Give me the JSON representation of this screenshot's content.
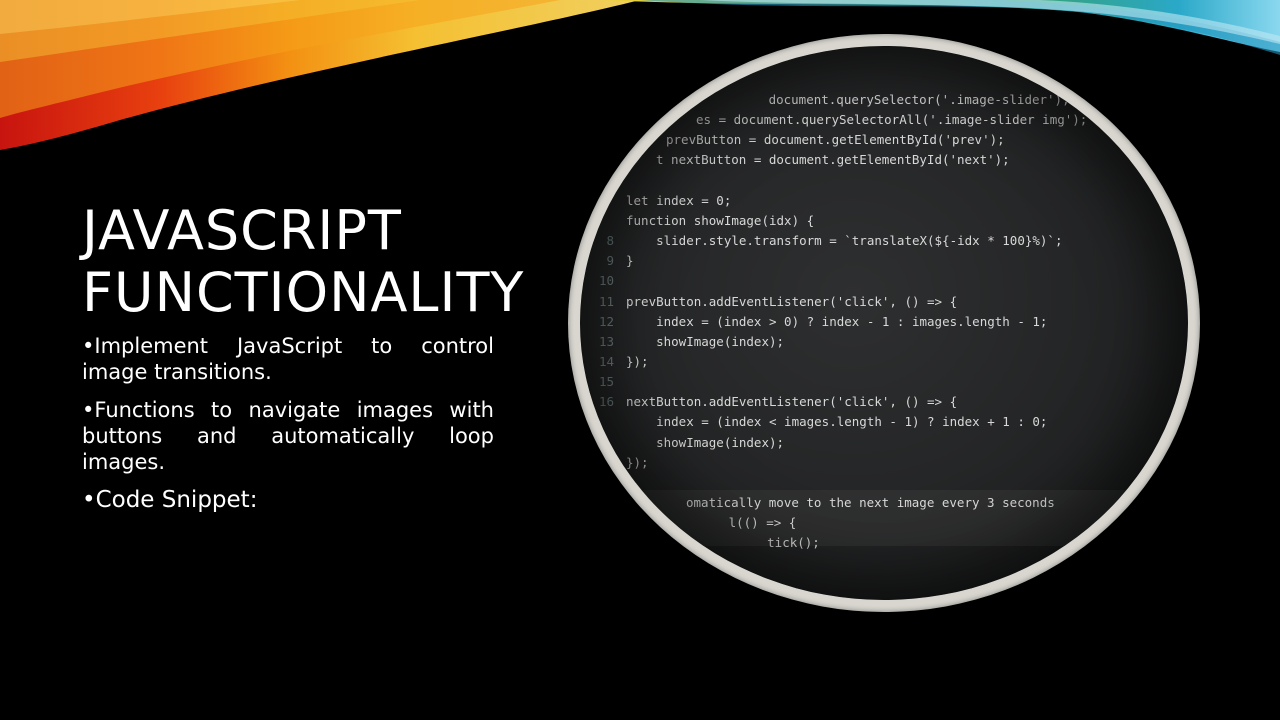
{
  "slide": {
    "title_lines": [
      "JAVASCRIPT",
      "FUNCTIONALITY"
    ],
    "bullets": [
      "•Implement JavaScript to control image transitions.",
      "•Functions to navigate images with buttons and automatically loop images.",
      "•Code Snippet:"
    ]
  },
  "code_image": {
    "lines": [
      {
        "ln": "",
        "text": "   document.querySelector('.image-slider');"
      },
      {
        "ln": "",
        "text": "es = document.querySelectorAll('.image-slider img');"
      },
      {
        "ln": "",
        "text": "prevButton = document.getElementById('prev');"
      },
      {
        "ln": "",
        "text": "t nextButton = document.getElementById('next');"
      },
      {
        "ln": "",
        "text": ""
      },
      {
        "ln": "",
        "text": "let index = 0;"
      },
      {
        "ln": "",
        "text": "function showImage(idx) {"
      },
      {
        "ln": "8",
        "text": "    slider.style.transform = `translateX(${-idx * 100}%)`;"
      },
      {
        "ln": "9",
        "text": "}"
      },
      {
        "ln": "10",
        "text": ""
      },
      {
        "ln": "11",
        "text": "prevButton.addEventListener('click', () => {"
      },
      {
        "ln": "12",
        "text": "    index = (index > 0) ? index - 1 : images.length - 1;"
      },
      {
        "ln": "13",
        "text": "    showImage(index);"
      },
      {
        "ln": "14",
        "text": "});"
      },
      {
        "ln": "15",
        "text": ""
      },
      {
        "ln": "16",
        "text": "nextButton.addEventListener('click', () => {"
      },
      {
        "ln": "",
        "text": "    index = (index < images.length - 1) ? index + 1 : 0;"
      },
      {
        "ln": "",
        "text": "    showImage(index);"
      },
      {
        "ln": "",
        "text": "});"
      },
      {
        "ln": "",
        "text": ""
      },
      {
        "ln": "",
        "text": "omatically move to the next image every 3 seconds"
      },
      {
        "ln": "",
        "text": "   l(() => {"
      },
      {
        "ln": "",
        "text": "      tick();"
      }
    ]
  },
  "colors": {
    "background": "#000000",
    "ribbon": [
      "#d81f16",
      "#f07a12",
      "#f7c52c",
      "#3d9b5a",
      "#2aa6c9"
    ],
    "frame": "#d8d6cf",
    "code_bg": "#262728"
  }
}
